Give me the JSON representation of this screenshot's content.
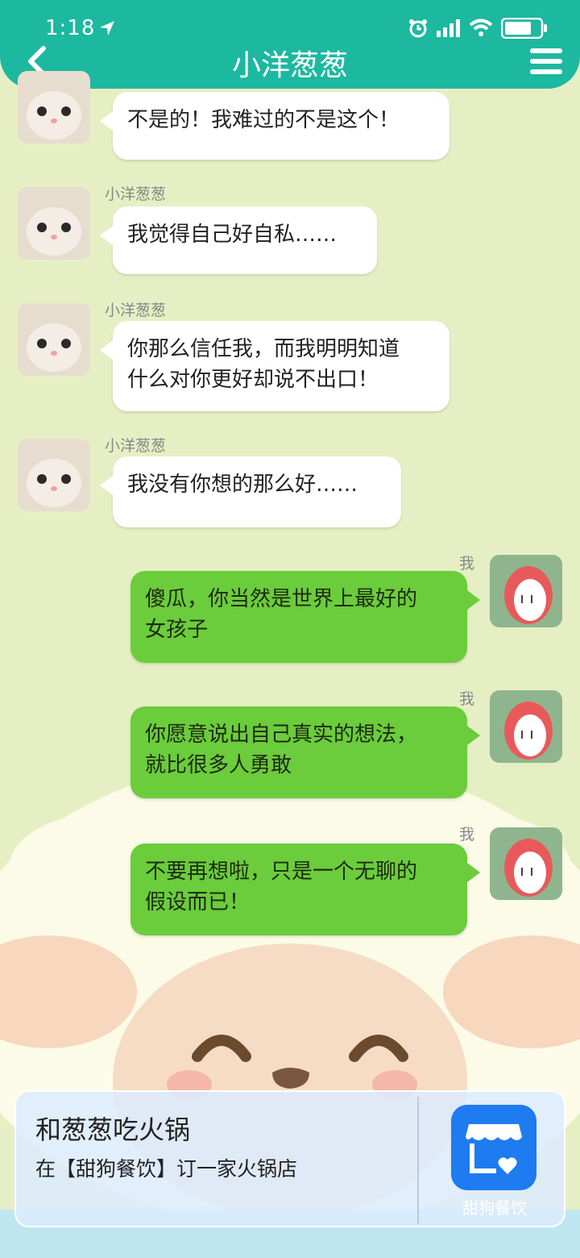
{
  "status": {
    "time": "1:18"
  },
  "header": {
    "title": "小洋葱葱"
  },
  "messages": [
    {
      "side": "left",
      "sender": "",
      "lines": [
        "不是的！我难过的不是这个！"
      ]
    },
    {
      "side": "left",
      "sender": "小洋葱葱",
      "lines": [
        "我觉得自己好自私……"
      ]
    },
    {
      "side": "left",
      "sender": "小洋葱葱",
      "lines": [
        "你那么信任我，而我明明知道",
        "什么对你更好却说不出口！"
      ]
    },
    {
      "side": "left",
      "sender": "小洋葱葱",
      "lines": [
        "我没有你想的那么好……"
      ]
    },
    {
      "side": "right",
      "sender": "我",
      "lines": [
        "傻瓜，你当然是世界上最好的",
        "女孩子"
      ]
    },
    {
      "side": "right",
      "sender": "我",
      "lines": [
        "你愿意说出自己真实的想法，",
        "就比很多人勇敢"
      ]
    },
    {
      "side": "right",
      "sender": "我",
      "lines": [
        "不要再想啦，只是一个无聊的",
        "假设而已！"
      ]
    }
  ],
  "ad": {
    "title": "和葱葱吃火锅",
    "subtitle": "在【甜狗餐饮】订一家火锅店",
    "app_name": "甜狗餐饮"
  },
  "colors": {
    "header": "#1db8a0",
    "bg": "#e6efc4",
    "my_bubble": "#6bcc3c",
    "ad_icon": "#1e7bf0"
  },
  "icons": [
    "location-arrow-icon",
    "alarm-icon",
    "signal-icon",
    "wifi-icon",
    "battery-icon",
    "back-icon",
    "menu-icon",
    "store-icon"
  ]
}
